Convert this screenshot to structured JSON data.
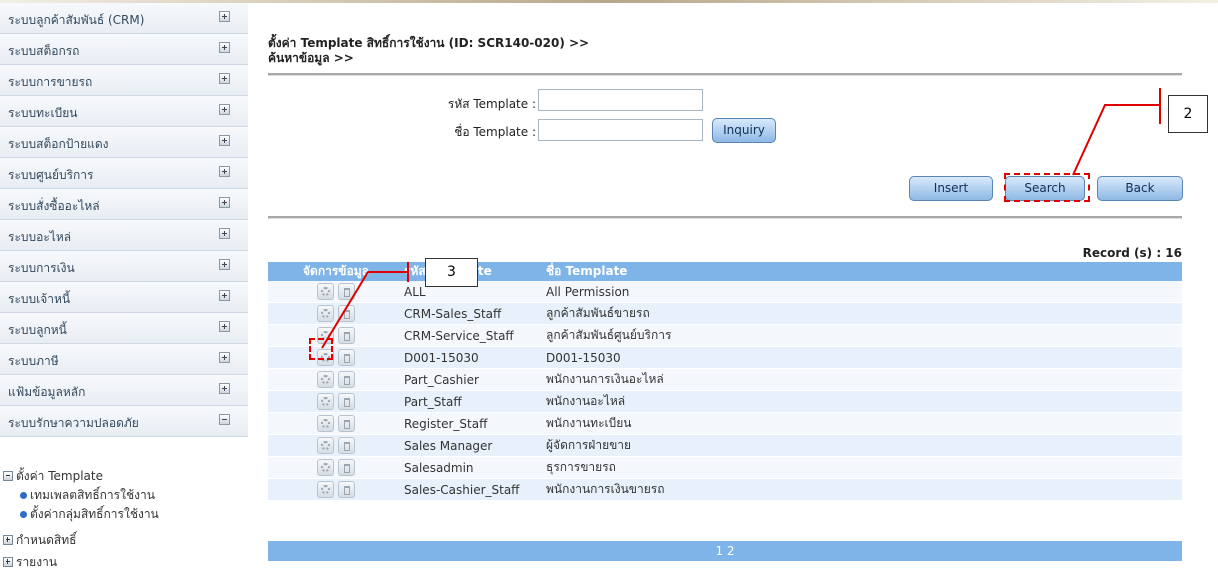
{
  "sidebar": {
    "items": [
      {
        "label": "ระบบลูกค้าสัมพันธ์ (CRM)",
        "state": "plus"
      },
      {
        "label": "ระบบสต็อกรถ",
        "state": "plus"
      },
      {
        "label": "ระบบการขายรถ",
        "state": "plus"
      },
      {
        "label": "ระบบทะเบียน",
        "state": "plus"
      },
      {
        "label": "ระบบสต็อกป้ายแดง",
        "state": "plus"
      },
      {
        "label": "ระบบศูนย์บริการ",
        "state": "plus"
      },
      {
        "label": "ระบบสั่งซื้ออะไหล่",
        "state": "plus"
      },
      {
        "label": "ระบบอะไหล่",
        "state": "plus"
      },
      {
        "label": "ระบบการเงิน",
        "state": "plus"
      },
      {
        "label": "ระบบเจ้าหนี้",
        "state": "plus"
      },
      {
        "label": "ระบบลูกหนี้",
        "state": "plus"
      },
      {
        "label": "ระบบภาษี",
        "state": "plus"
      },
      {
        "label": "แฟ้มข้อมูลหลัก",
        "state": "plus"
      },
      {
        "label": "ระบบรักษาความปลอดภัย",
        "state": "minus"
      }
    ],
    "tree": {
      "template_group": "ตั้งค่า Template",
      "template_children": [
        "เทมเพลตสิทธิ์การใช้งาน",
        "ตั้งค่ากลุ่มสิทธิ์การใช้งาน"
      ],
      "permissions": "กำหนดสิทธิ์",
      "reports": "รายงาน"
    }
  },
  "header": {
    "title_line1": "ตั้งค่า Template สิทธิ์การใช้งาน (ID: SCR140-020) >>",
    "title_line2": "ค้นหาข้อมูล >>"
  },
  "form": {
    "template_code_label": "รหัส Template :",
    "template_code_value": "",
    "template_name_label": "ชื่อ Template :",
    "template_name_value": "",
    "inquiry_label": "Inquiry"
  },
  "toolbar": {
    "insert_label": "Insert",
    "search_label": "Search",
    "back_label": "Back"
  },
  "record_count": "Record (s) : 16",
  "table": {
    "columns": [
      "จัดการข้อมูล",
      "รหัส Template",
      "ชื่อ Template"
    ],
    "rows": [
      {
        "code": "ALL",
        "name": "All Permission"
      },
      {
        "code": "CRM-Sales_Staff",
        "name": "ลูกค้าสัมพันธ์ขายรถ"
      },
      {
        "code": "CRM-Service_Staff",
        "name": "ลูกค้าสัมพันธ์ศูนย์บริการ"
      },
      {
        "code": "D001-15030",
        "name": "D001-15030"
      },
      {
        "code": "Part_Cashier",
        "name": "พนักงานการเงินอะไหล่"
      },
      {
        "code": "Part_Staff",
        "name": "พนักงานอะไหล่"
      },
      {
        "code": "Register_Staff",
        "name": "พนักงานทะเบียน"
      },
      {
        "code": "Sales Manager",
        "name": "ผู้จัดการฝ่ายขาย"
      },
      {
        "code": "Salesadmin",
        "name": "ธุรการขายรถ"
      },
      {
        "code": "Sales-Cashier_Staff",
        "name": "พนักงานการเงินขายรถ"
      }
    ],
    "pager": "1 2"
  },
  "annotations": {
    "callout_search": "2",
    "callout_edit": "3",
    "accent": "#e00000"
  }
}
